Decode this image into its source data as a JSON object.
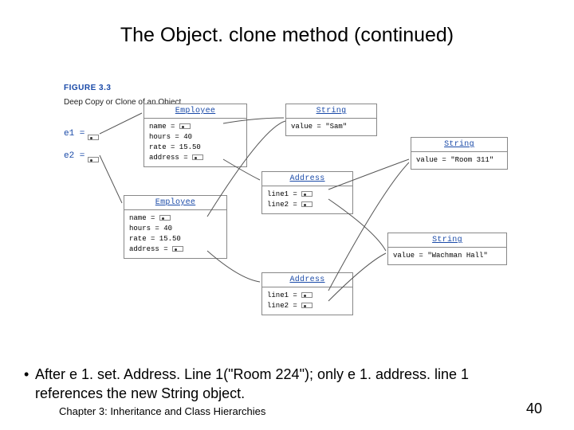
{
  "title": "The Object. clone method (continued)",
  "figure": {
    "label": "FIGURE 3.3",
    "caption": "Deep Copy or Clone of an Object"
  },
  "vars": {
    "e1": "e1 =",
    "e2": "e2 ="
  },
  "boxes": {
    "emp1": {
      "header": "Employee",
      "l1": "name =",
      "l2": "hours = 40",
      "l3": "rate = 15.50",
      "l4": "address ="
    },
    "emp2": {
      "header": "Employee",
      "l1": "name =",
      "l2": "hours = 40",
      "l3": "rate = 15.50",
      "l4": "address ="
    },
    "str1": {
      "header": "String",
      "value": "value = \"Sam\""
    },
    "str2": {
      "header": "String",
      "value": "value = \"Room 311\""
    },
    "str3": {
      "header": "String",
      "value": "value = \"Wachman Hall\""
    },
    "addr1": {
      "header": "Address",
      "l1": "line1 =",
      "l2": "line2 ="
    },
    "addr2": {
      "header": "Address",
      "l1": "line1 =",
      "l2": "line2 ="
    }
  },
  "bullet": "After e 1. set. Address. Line 1(\"Room 224\"); only e 1. address. line 1 references the new String object.",
  "footer": {
    "chapter": "Chapter 3: Inheritance and Class Hierarchies",
    "page": "40"
  }
}
